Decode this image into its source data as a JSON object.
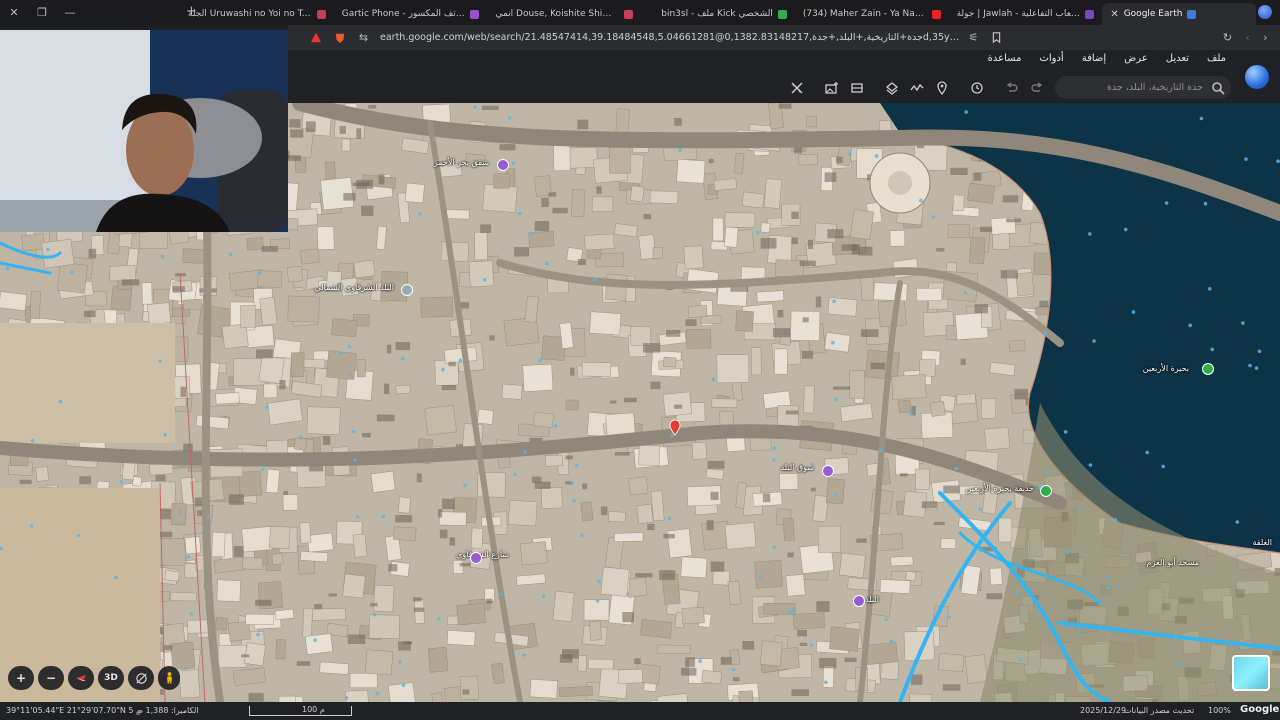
{
  "browser": {
    "tabs": [
      {
        "title": "الجلة Uruwashi no Yoi no Tsuki انمي",
        "color": "#c73e57"
      },
      {
        "title": "Gartic Phone - لعبة الهاتف المكسور",
        "color": "#9b4fd1"
      },
      {
        "title": "انمي Douse, Koishite Shimaunda .الي",
        "color": "#c73e57"
      },
      {
        "title": "bin3sl - ملف Kick الشخصي",
        "color": "#2fae4b"
      },
      {
        "title": "(734) Maher Zain - Ya Nabi Salam Al",
        "color": "#e22"
      },
      {
        "title": "جولة | Jawlah - منصة الألعاب التفاعلية",
        "color": "#7a46c4"
      },
      {
        "title": "Google Earth",
        "color": "#3b7ddd",
        "active": true
      }
    ],
    "url": "earth.google.com/web/search/21.48547414,39.18484548,5.04661281@0,جدة+التاريخية,+البلد,+جدة,1382.83148217d,35y,256.40409071h,0t,0r/dat..."
  },
  "earth": {
    "menus": [
      "ملف",
      "تعديل",
      "عرض",
      "إضافة",
      "أدوات",
      "مساعدة"
    ],
    "search": {
      "placeholder": "جدة التاريخية، البلد، جدة"
    },
    "tools": [
      {
        "name": "redo-icon"
      },
      {
        "name": "undo-icon"
      },
      {
        "name": "history-icon"
      },
      {
        "name": "placemark-icon"
      },
      {
        "name": "path-icon"
      },
      {
        "name": "layers-icon"
      },
      {
        "name": "imagery-icon"
      },
      {
        "name": "add-photo-icon"
      },
      {
        "name": "measure-icon"
      }
    ],
    "map": {
      "labels": [
        {
          "text": "شقق بحر الأحمر"
        },
        {
          "text": "البلد الشرقاوي الشمالي"
        },
        {
          "text": "بحيرة الأربعين"
        },
        {
          "text": "سوق البلد"
        },
        {
          "text": "حديقة بحيرة الأربعين"
        },
        {
          "text": "مسجد أبو العزم"
        },
        {
          "text": "شارع الشرقاوي"
        },
        {
          "text": "البلد"
        },
        {
          "text": "الغلقة"
        }
      ],
      "selected_pin_color": "#e53935",
      "water_color": "#0c3346",
      "road_color": "#33b5f2"
    },
    "controls": {
      "zoom_in": "+",
      "zoom_out": "−",
      "mode_3d": "3D"
    },
    "status": {
      "coords": "39°11'05.44\"E 21°29'07.70\"N  5 م",
      "camera": "الكاميرا: 1,388 م",
      "scale": "100 م",
      "date": "2025/12/29",
      "source": "تحديث مصدر البيانات",
      "zoom": "100%",
      "brand": "Google"
    }
  }
}
